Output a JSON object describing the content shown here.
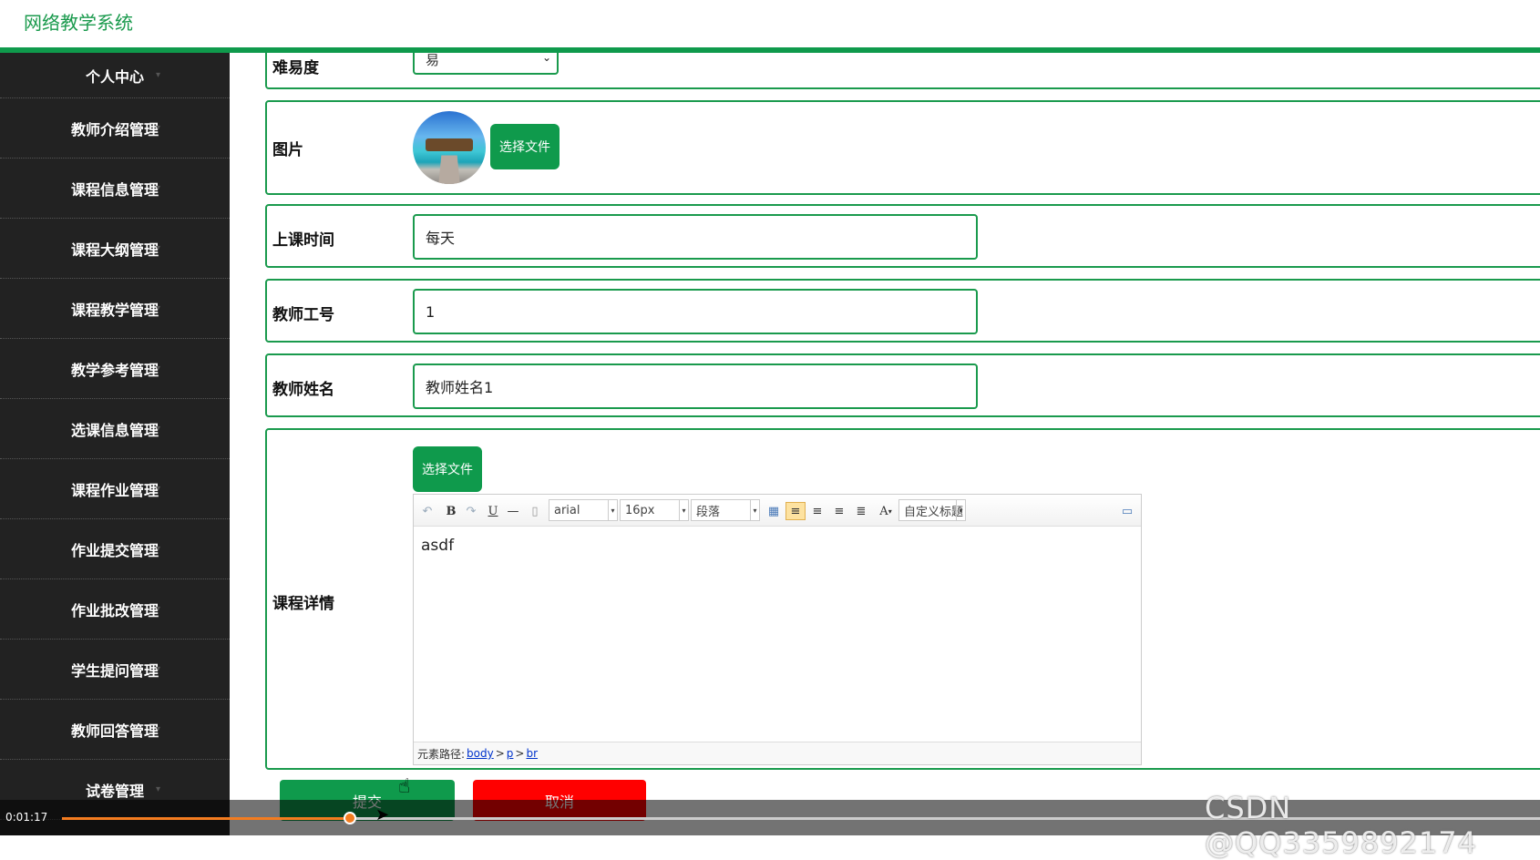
{
  "app": {
    "title": "网络教学系统"
  },
  "sidebar": {
    "items": [
      {
        "label": "个人中心"
      },
      {
        "label": "教师介绍管理"
      },
      {
        "label": "课程信息管理"
      },
      {
        "label": "课程大纲管理"
      },
      {
        "label": "课程教学管理"
      },
      {
        "label": "教学参考管理"
      },
      {
        "label": "选课信息管理"
      },
      {
        "label": "课程作业管理"
      },
      {
        "label": "作业提交管理"
      },
      {
        "label": "作业批改管理"
      },
      {
        "label": "学生提问管理"
      },
      {
        "label": "教师回答管理"
      },
      {
        "label": "试卷管理"
      }
    ]
  },
  "form": {
    "difficulty": {
      "label": "难易度",
      "value": "易"
    },
    "image": {
      "label": "图片",
      "button": "选择文件"
    },
    "class_time": {
      "label": "上课时间",
      "value": "每天"
    },
    "teacher_id": {
      "label": "教师工号",
      "value": "1"
    },
    "teacher_name": {
      "label": "教师姓名",
      "value": "教师姓名1"
    },
    "details": {
      "label": "课程详情",
      "button": "选择文件",
      "editor": {
        "font": "arial",
        "size": "16px",
        "paragraph": "段落",
        "custom_title": "自定义标题",
        "content": "asdf",
        "path_label": "元素路径:",
        "path": [
          "body",
          "p",
          "br"
        ]
      }
    },
    "submit": "提交",
    "cancel": "取消"
  },
  "video": {
    "time": "0:01:17",
    "progress": 0.195
  },
  "watermark": "CSDN @QQ3359892174",
  "colors": {
    "accent": "#0f9a4c",
    "danger": "#ff0000",
    "sidebar": "#222222"
  }
}
